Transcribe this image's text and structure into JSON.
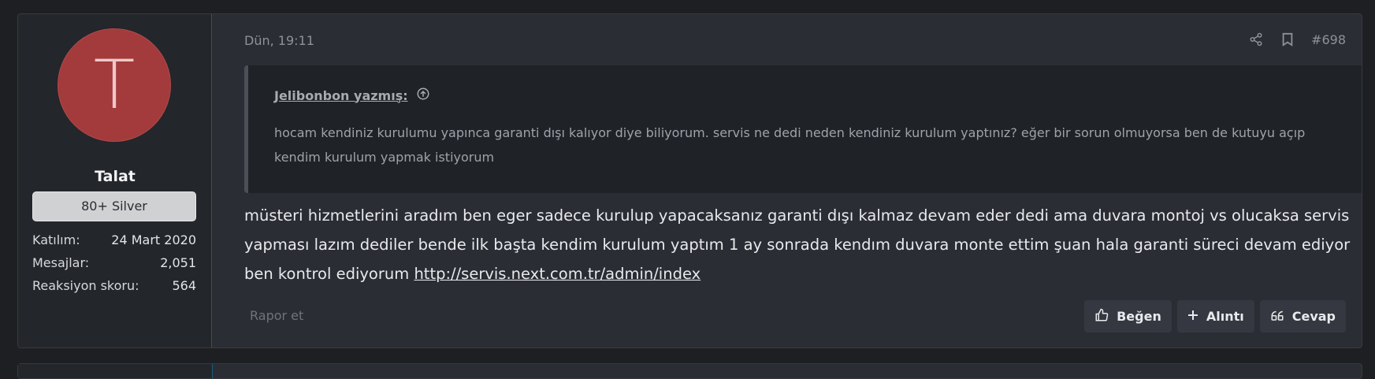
{
  "post": {
    "user": {
      "avatar_letter": "T",
      "avatar_color": "#a33a3b",
      "name": "Talat",
      "title": "80+ Silver",
      "stats": [
        {
          "label": "Katılım:",
          "value": "24 Mart 2020"
        },
        {
          "label": "Mesajlar:",
          "value": "2,051"
        },
        {
          "label": "Reaksiyon skoru:",
          "value": "564"
        }
      ]
    },
    "date": "Dün, 19:11",
    "post_number": "#698",
    "top_icons": [
      "share-icon",
      "bookmark-icon"
    ],
    "quote": {
      "author": "Jelibonbon yazmış:",
      "text": "hocam kendiniz kurulumu yapınca garanti dışı kalıyor diye biliyorum. servis ne dedi neden kendiniz kurulum yaptınız? eğer bir sorun olmuyorsa ben de kutuyu açıp kendim kurulum yapmak istiyorum"
    },
    "message": {
      "text": "müsteri hizmetlerini aradım ben eger sadece kurulup yapacaksanız garanti dışı kalmaz devam eder dedi ama duvara montoj vs olucaksa servis yapması lazım dediler bende ilk başta kendim kurulum yaptım 1 ay sonrada kendım duvara monte ettim şuan hala garanti süreci devam ediyor ben kontrol ediyorum ",
      "link": "http://servis.next.com.tr/admin/index"
    },
    "report_label": "Rapor et",
    "buttons": {
      "like": "Beğen",
      "quote": "Alıntı",
      "reply": "Cevap"
    }
  }
}
